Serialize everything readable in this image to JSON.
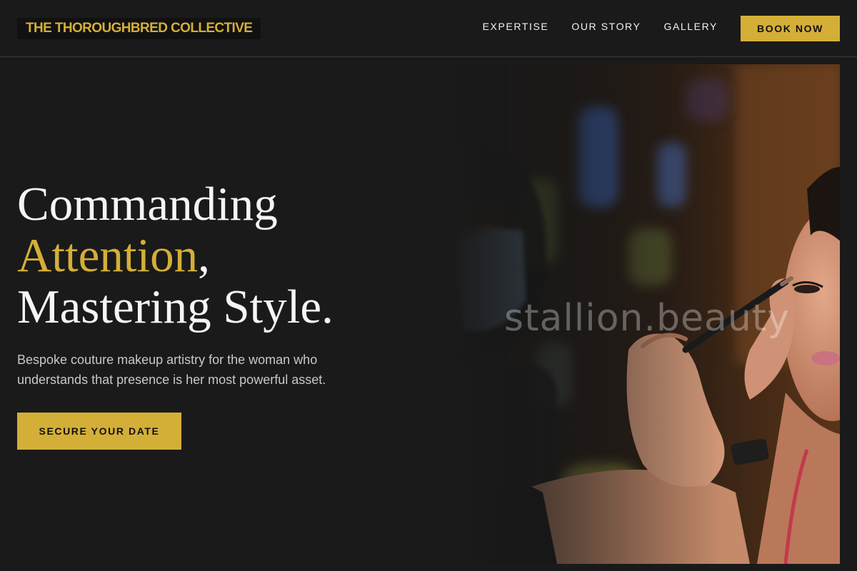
{
  "header": {
    "brand": "THE THOROUGHBRED COLLECTIVE",
    "nav": [
      {
        "label": "EXPERTISE"
      },
      {
        "label": "OUR STORY"
      },
      {
        "label": "GALLERY"
      }
    ],
    "book_label": "BOOK NOW"
  },
  "hero": {
    "title_line1": "Commanding",
    "title_accent": "Attention",
    "title_comma": ",",
    "title_line3": "Mastering Style.",
    "subtitle": "Bespoke couture makeup artistry for the woman who understands that presence is her most powerful asset.",
    "cta_label": "SECURE YOUR DATE",
    "image_watermark": "stallion.beauty"
  },
  "colors": {
    "background": "#1a1a1a",
    "accent_gold": "#d4af37",
    "text_light": "#f2f2f2",
    "text_muted": "#c8c8c8"
  }
}
